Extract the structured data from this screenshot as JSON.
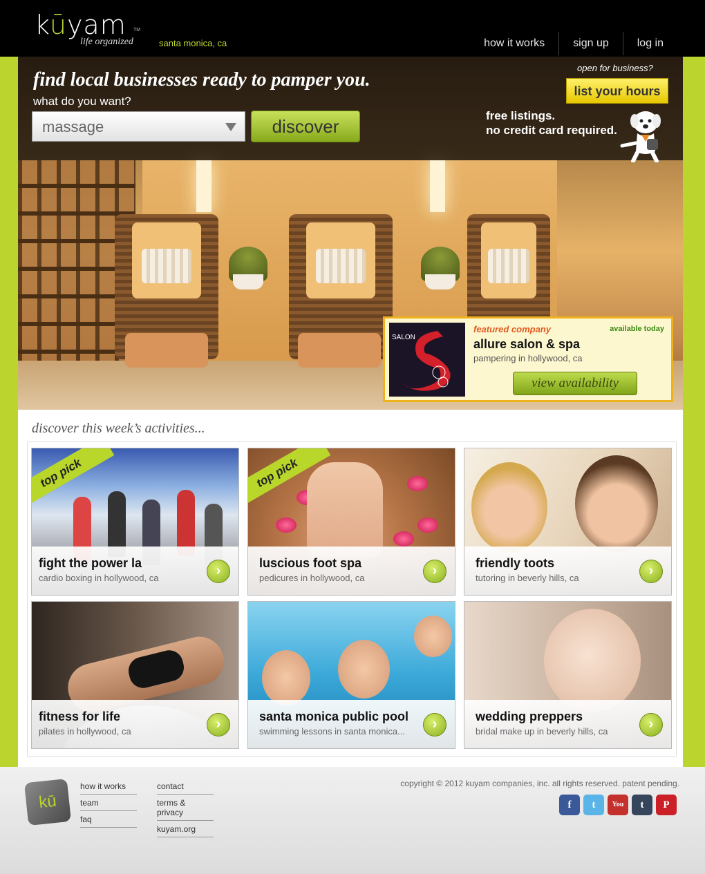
{
  "header": {
    "logo_text": "kūyam",
    "logo_tm": "TM",
    "tagline": "life organized",
    "location": "santa monica, ca",
    "nav": [
      "how it works",
      "sign up",
      "log in"
    ]
  },
  "search": {
    "headline": "find local businesses ready to pamper you.",
    "label": "what do you want?",
    "selected": "massage",
    "button": "discover"
  },
  "promo": {
    "open_text": "open for business?",
    "button": "list your hours",
    "line1": "free listings.",
    "line2": "no credit card required."
  },
  "featured": {
    "kicker": "featured company",
    "availability": "available today",
    "name": "allure salon & spa",
    "desc": "pampering in hollywood, ca",
    "button": "view availability",
    "logo_text": "SALON"
  },
  "activities": {
    "heading": "discover this week’s activities...",
    "ribbon": "top pick",
    "cards": [
      {
        "title": "fight the power la",
        "sub": "cardio boxing in hollywood, ca"
      },
      {
        "title": "luscious foot spa",
        "sub": "pedicures in hollywood, ca"
      },
      {
        "title": "friendly toots",
        "sub": "tutoring in beverly hills, ca"
      },
      {
        "title": "fitness for life",
        "sub": "pilates in hollywood, ca"
      },
      {
        "title": "santa monica public pool",
        "sub": "swimming lessons in santa monica..."
      },
      {
        "title": "wedding preppers",
        "sub": "bridal make up in beverly hills, ca"
      }
    ]
  },
  "footer": {
    "logo_text": "kū",
    "col1": [
      "how it works",
      "team",
      "faq"
    ],
    "col2": [
      "contact",
      "terms & privacy",
      "kuyam.org"
    ],
    "copyright": "copyright © 2012 kuyam companies, inc. all rights reserved. patent pending.",
    "social": [
      {
        "name": "facebook-icon",
        "glyph": "f",
        "color": "#3b5998"
      },
      {
        "name": "twitter-icon",
        "glyph": "t",
        "color": "#5ab4e8"
      },
      {
        "name": "youtube-icon",
        "glyph": "You",
        "color": "#c4302b"
      },
      {
        "name": "tumblr-icon",
        "glyph": "t",
        "color": "#35465c"
      },
      {
        "name": "pinterest-icon",
        "glyph": "P",
        "color": "#cb2027"
      }
    ]
  },
  "colors": {
    "accent_green": "#bcd52e",
    "header_bg": "#000000",
    "featured_border": "#f0b21c"
  }
}
